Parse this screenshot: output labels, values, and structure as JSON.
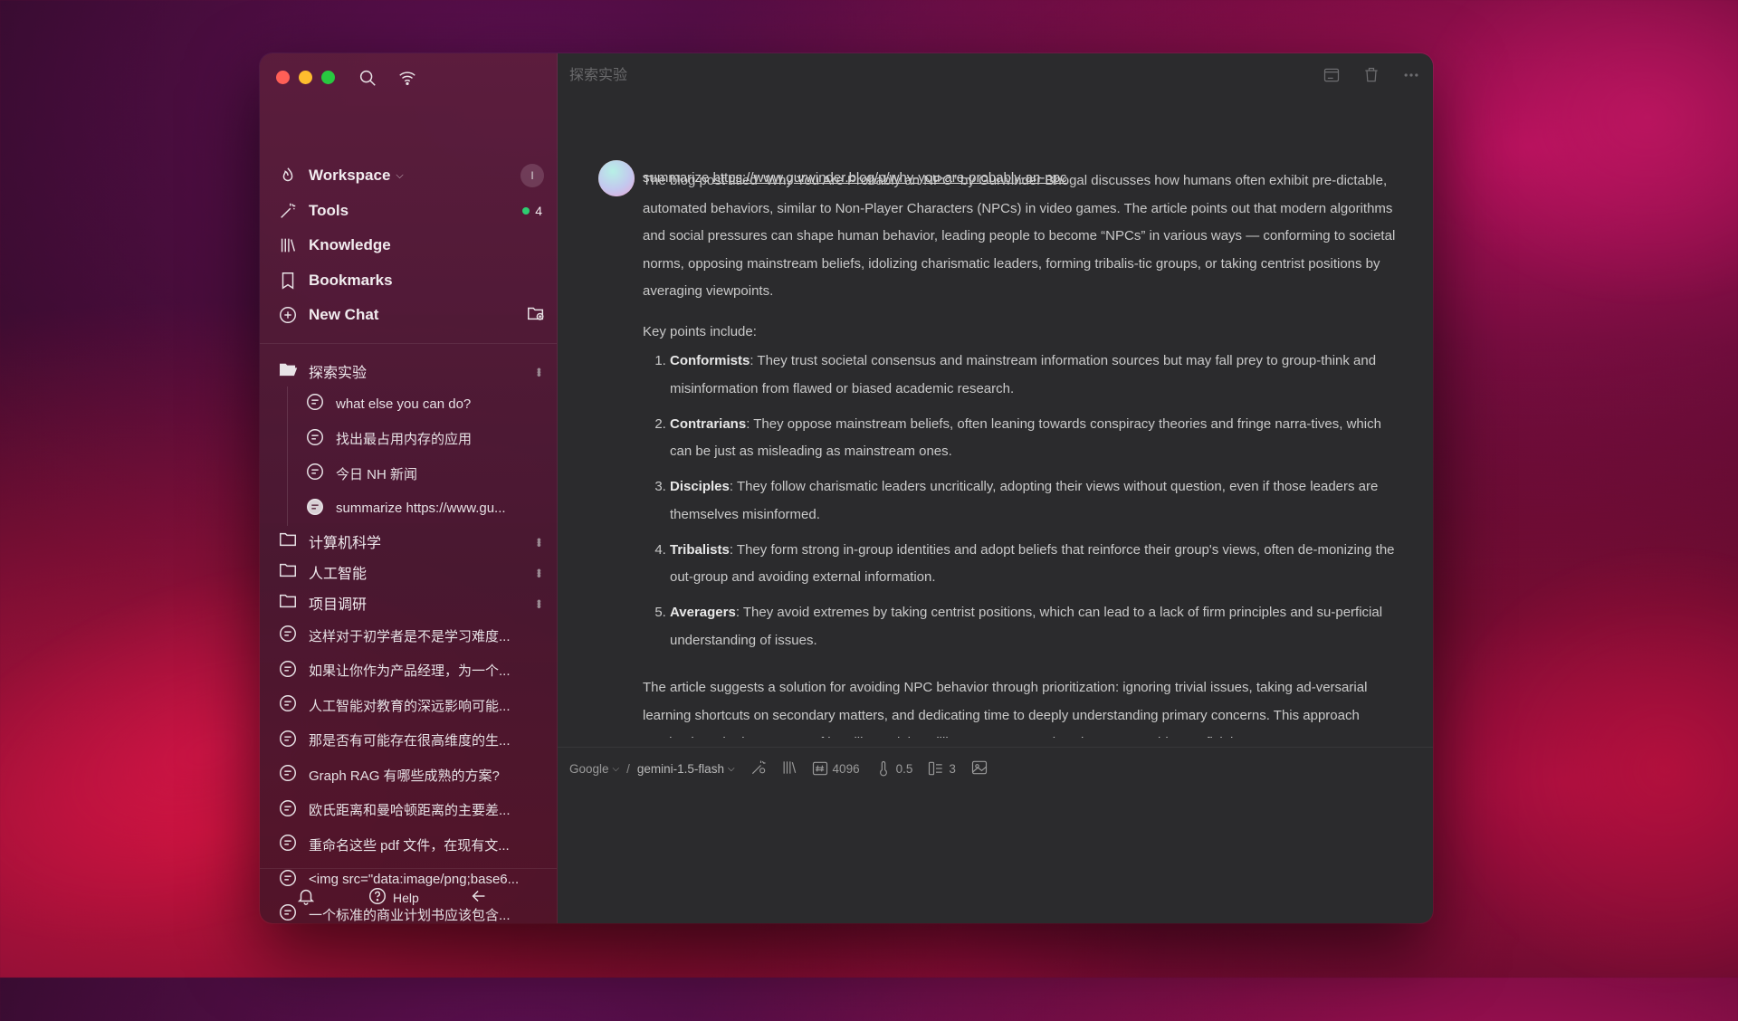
{
  "sidebar": {
    "nav": [
      {
        "label": "Workspace",
        "icon": "workspace-icon"
      },
      {
        "label": "Tools",
        "icon": "tools-icon"
      },
      {
        "label": "Knowledge",
        "icon": "knowledge-icon"
      },
      {
        "label": "Bookmarks",
        "icon": "bookmark-icon"
      },
      {
        "label": "New Chat",
        "icon": "new-chat-icon"
      }
    ],
    "workspace_badge": "I",
    "tools_count": "4",
    "folders": {
      "open": {
        "name": "探索实验",
        "chats": [
          "what else you can do?",
          "找出最占用内存的应用",
          "今日 NH 新闻",
          "summarize https://www.gu..."
        ]
      },
      "closed": [
        "计算机科学",
        "人工智能",
        "项目调研"
      ]
    },
    "chats": [
      "这样对于初学者是不是学习难度...",
      "如果让你作为产品经理，为一个...",
      "人工智能对教育的深远影响可能...",
      "那是否有可能存在很高维度的生...",
      "Graph RAG 有哪些成熟的方案?",
      "欧氏距离和曼哈顿距离的主要差...",
      "重命名这些 pdf 文件，在现有文...",
      "<img src=\"data:image/png;base6...",
      "一个标准的商业计划书应该包含..."
    ],
    "bottom": {
      "help": "Help"
    }
  },
  "main": {
    "title": "探索实验",
    "user_message": {
      "prefix": "summarize ",
      "link": "https://www.gurwinder.blog/p/why-you-are-probably-an-npc"
    },
    "reply": {
      "intro": "The blog post titled “Why You Are Probably an NPC” by Gurwinder Bhogal discusses how humans often exhibit pre-dictable, automated behaviors, similar to Non-Player Characters (NPCs) in video games. The article points out that modern algorithms and social pressures can shape human behavior, leading people to become “NPCs” in various ways — conforming to societal norms, opposing mainstream beliefs, idolizing charismatic leaders, forming tribalis-tic groups, or taking centrist positions by averaging viewpoints.",
      "key_points_label": "Key points include:",
      "points": [
        {
          "term": "Conformists",
          "text": ": They trust societal consensus and mainstream information sources but may fall prey to group-think and misinformation from flawed or biased academic research."
        },
        {
          "term": "Contrarians",
          "text": ": They oppose mainstream beliefs, often leaning towards conspiracy theories and fringe narra-tives, which can be just as misleading as mainstream ones."
        },
        {
          "term": "Disciples",
          "text": ": They follow charismatic leaders uncritically, adopting their views without question, even if those leaders are themselves misinformed."
        },
        {
          "term": "Tribalists",
          "text": ": They form strong in-group identities and adopt beliefs that reinforce their group's views, often de-monizing the out-group and avoiding external information."
        },
        {
          "term": "Averagers",
          "text": ": They avoid extremes by taking centrist positions, which can lead to a lack of firm principles and su-perficial understanding of issues."
        }
      ],
      "conclusion": "The article suggests a solution for avoiding NPC behavior through prioritization: ignoring trivial issues, taking ad-versarial learning shortcuts on secondary matters, and dedicating time to deeply understanding primary concerns. This approach emphasizes the importance of humility and the willingness to say “I don't know” to avoid superficial"
    },
    "composer": {
      "provider": "Google",
      "model": "gemini-1.5-flash",
      "max_tokens": "4096",
      "temperature": "0.5",
      "context": "3"
    }
  }
}
